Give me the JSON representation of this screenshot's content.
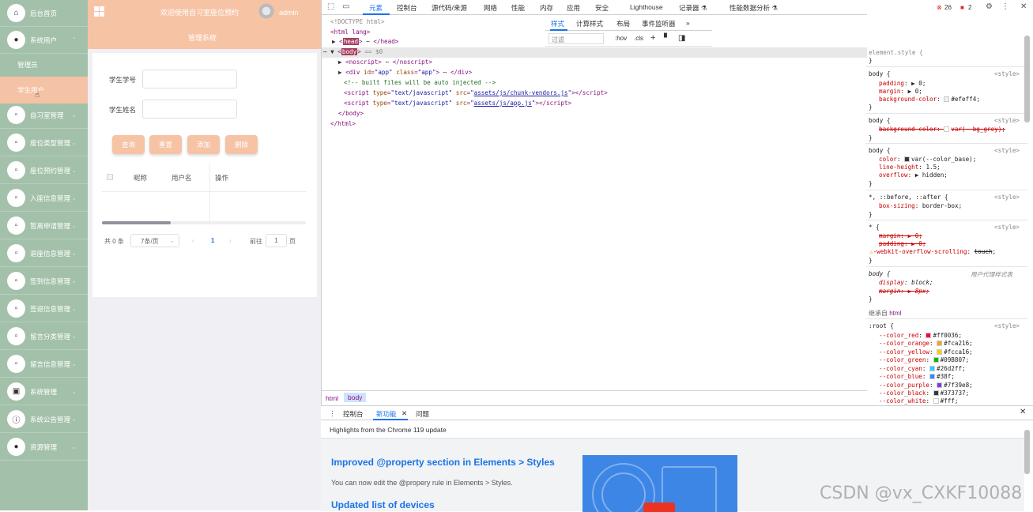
{
  "sidebar": {
    "items": [
      {
        "label": "后台首页",
        "icon": "home-icon"
      },
      {
        "label": "系统用户",
        "icon": "user-icon"
      },
      {
        "label": "自习室管理",
        "icon": "room-icon"
      },
      {
        "label": "座位类型管理",
        "icon": "seat-type-icon"
      },
      {
        "label": "座位预约管理",
        "icon": "seat-booking-icon"
      },
      {
        "label": "入座信息管理",
        "icon": "checkin-icon"
      },
      {
        "label": "暂离申请管理",
        "icon": "leave-icon"
      },
      {
        "label": "退座信息管理",
        "icon": "exit-icon"
      },
      {
        "label": "签到信息管理",
        "icon": "signin-icon"
      },
      {
        "label": "签退信息管理",
        "icon": "signout-icon"
      },
      {
        "label": "留言分类管理",
        "icon": "message-category-icon"
      },
      {
        "label": "留言信息管理",
        "icon": "message-icon"
      },
      {
        "label": "系统管理",
        "icon": "image-icon"
      },
      {
        "label": "系统公告管理",
        "icon": "info-icon"
      },
      {
        "label": "资源管理",
        "icon": "resource-icon"
      }
    ],
    "submenu": [
      {
        "label": "管理员"
      },
      {
        "label": "学生用户"
      }
    ]
  },
  "header": {
    "welcome": "欢迎使用自习室座位预约",
    "subtitle": "管理系统",
    "user": "admin"
  },
  "form": {
    "student_id_label": "学生学号",
    "student_name_label": "学生姓名",
    "student_id_value": "",
    "student_name_value": ""
  },
  "buttons": {
    "query": "查询",
    "reset": "重置",
    "add": "添加",
    "delete": "删除"
  },
  "table": {
    "headers": [
      "昵称",
      "用户名",
      "操作"
    ]
  },
  "pagination": {
    "total": "共 0 条",
    "page_size": "7条/页",
    "current_page": "1",
    "goto_label": "前往",
    "goto_value": "1",
    "page_unit": "页"
  },
  "devtools": {
    "tabs": [
      "元素",
      "控制台",
      "源代码/来源",
      "网络",
      "性能",
      "内存",
      "应用",
      "安全",
      "Lighthouse",
      "记录器 ⚗",
      "性能数据分析 ⚗"
    ],
    "error_count": "26",
    "warning_count": "2",
    "dom": {
      "doctype": "<!DOCTYPE html>",
      "html_open": "<html lang>",
      "head": "head",
      "body": "body",
      "body_suffix": "== $0",
      "noscript": "<noscript>",
      "noscript_close": "</noscript>",
      "div_id": "app",
      "div_class": "app",
      "comment": "<!-- built files will be auto injected -->",
      "script1_src": "assets/js/chunk-vendors.js",
      "script2_src": "assets/js/app.js",
      "script_type": "text/javascript",
      "body_close": "</body>",
      "html_close": "</html>"
    },
    "breadcrumbs": [
      "html",
      "body"
    ],
    "styles_tabs": [
      "样式",
      "计算样式",
      "布局",
      "事件监听器"
    ],
    "filter_placeholder": "过滤",
    "hov": ":hov",
    "cls": ".cls",
    "source_style": "<style>",
    "ua_label": "用户代理样式表",
    "inherit_label": "继承自",
    "inherit_tag": "html"
  },
  "drawer": {
    "tabs": [
      "控制台",
      "新功能",
      "问题"
    ],
    "highlights": "Highlights from the Chrome 119 update",
    "heading1": "Improved @property section in Elements > Styles",
    "para1": "You can now edit the @propery rule in Elements > Styles.",
    "heading2": "Updated list of devices"
  },
  "watermark": "CSDN @vx_CXKF10088",
  "colors": {
    "sidebar": "#a3c1aa",
    "accent": "#f7c3a5",
    "devtools_blue": "#1a73e8",
    "color_red": "#ff0036",
    "color_orange": "#fca216",
    "color_yellow": "#fcca16",
    "color_green": "#09b807",
    "color_cyan": "#26d2ff",
    "color_blue": "#38f",
    "color_purple": "#7f39e8",
    "color_black": "#373737",
    "color_white": "#fff"
  }
}
